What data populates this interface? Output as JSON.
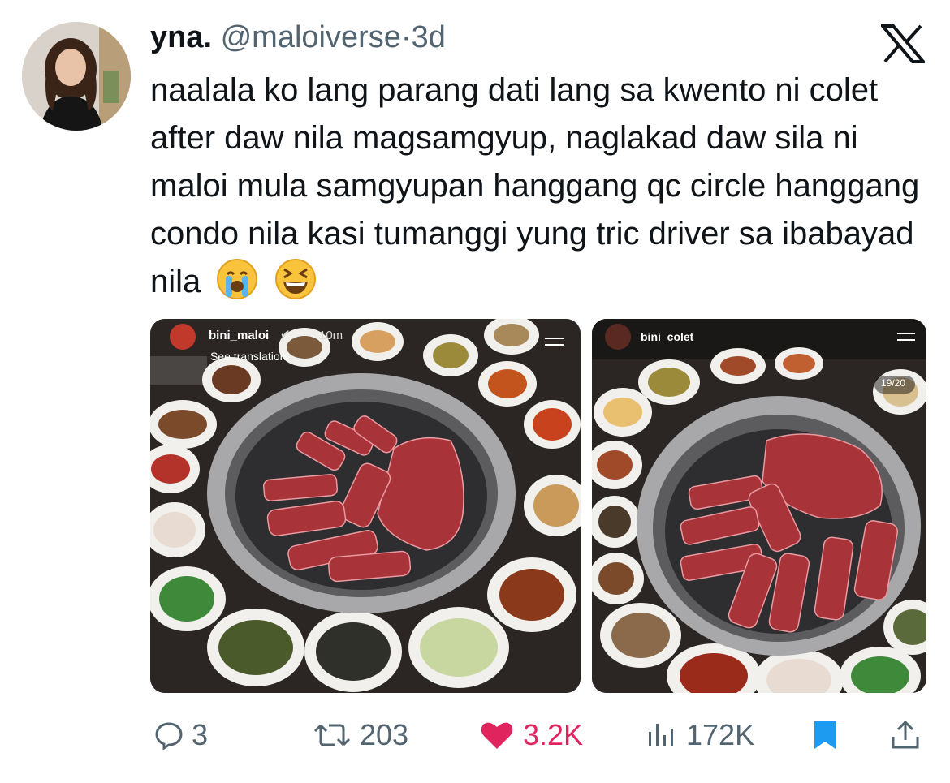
{
  "tweet": {
    "author_name": "yna.",
    "handle": "@maloiverse",
    "separator": "·",
    "time": "3d",
    "text": "naalala ko lang parang dati lang sa kwento ni colet after daw nila magsamgyup, naglakad daw sila ni maloi mula samgyupan hanggang qc circle hanggang condo nila kasi tumanggi yung tric driver sa ibabayad nila",
    "emojis": [
      "loudly-crying-face",
      "grinning-squinting-face"
    ]
  },
  "media": [
    {
      "username": "bini_maloi",
      "time": "10m",
      "see_translation": "See translation",
      "description": "korean bbq grill with marbled beef and banchan side dishes"
    },
    {
      "username": "bini_colet",
      "counter": "19/20",
      "description": "korean bbq grill with marbled beef and banchan side dishes"
    }
  ],
  "actions": {
    "replies": "3",
    "retweets": "203",
    "likes": "3.2K",
    "views": "172K"
  },
  "colors": {
    "like": "#e0245e",
    "bookmark": "#1d9bf0",
    "muted": "#536471"
  }
}
